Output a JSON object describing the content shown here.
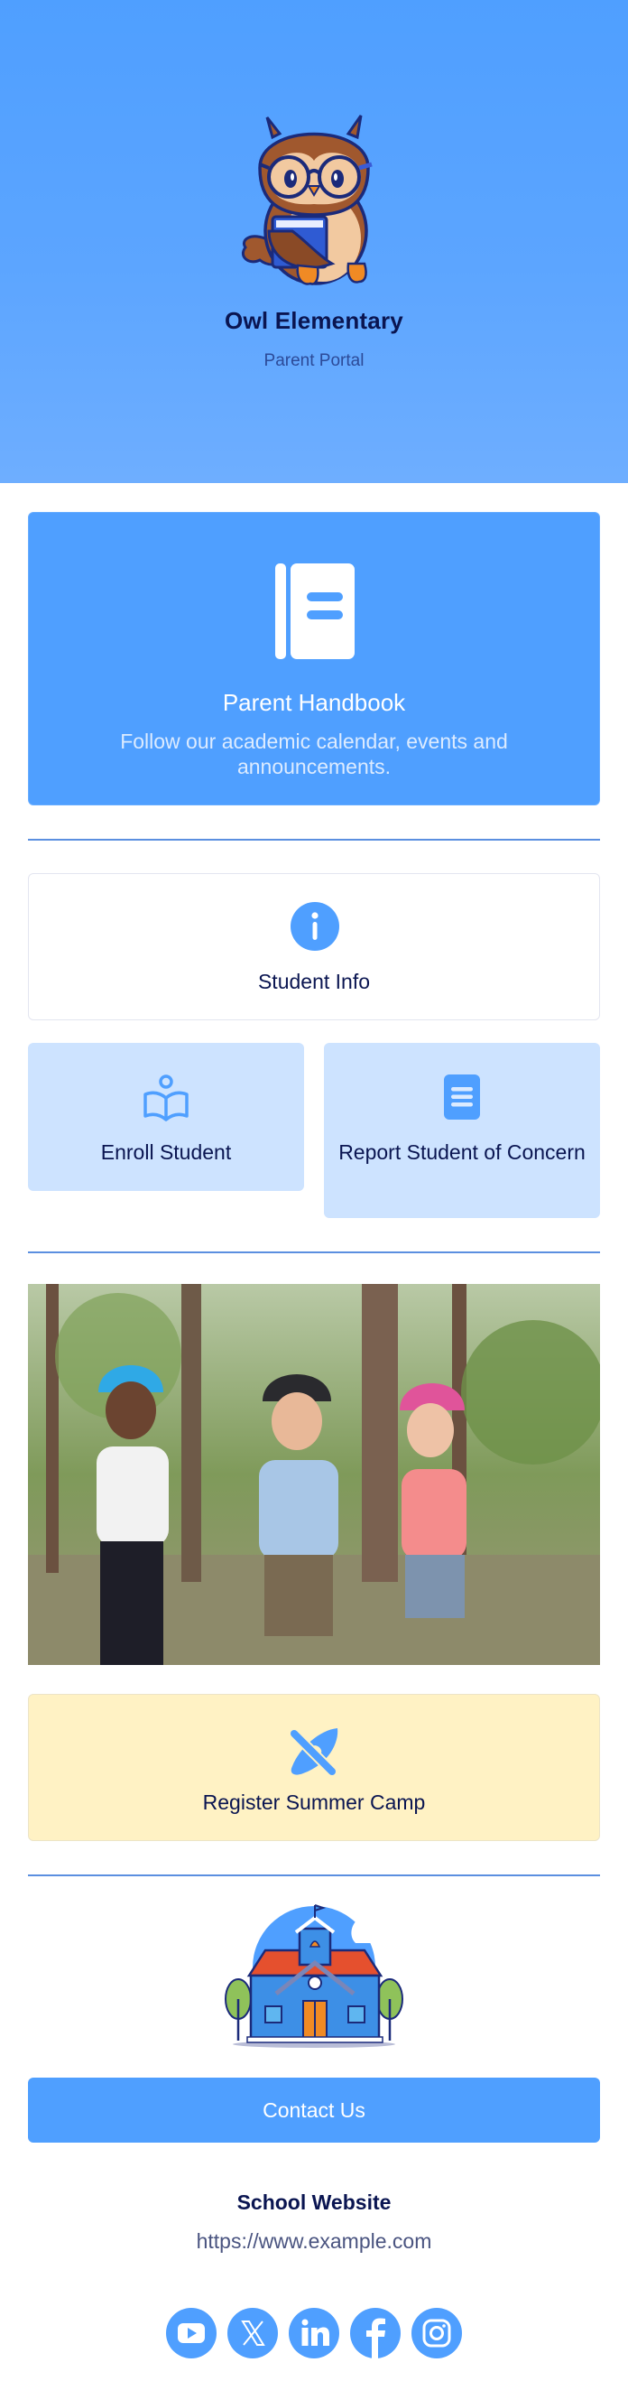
{
  "header": {
    "title": "Owl Elementary",
    "subtitle": "Parent Portal",
    "logo": "owl-reading-book-illustration",
    "gradient_top": "#4F9FFF",
    "gradient_bottom": "#6EAEFF"
  },
  "colors": {
    "primary": "#4F9FFF",
    "navy_text": "#0A1551",
    "tile_bg": "#CDE3FF",
    "camp_bg": "#FFF2C4",
    "divider": "#5B8FE0"
  },
  "handbook": {
    "icon": "notebook-icon",
    "title": "Parent Handbook",
    "description": "Follow our academic calendar, events and announcements."
  },
  "student_info": {
    "icon": "info-circle-icon",
    "label": "Student Info"
  },
  "tiles": [
    {
      "icon": "reading-person-icon",
      "label": "Enroll Student"
    },
    {
      "icon": "document-icon",
      "label": "Report Student of Concern"
    }
  ],
  "photo": {
    "description": "Three children wearing climbing helmets and harnesses holding ropes and carabiners in a forest"
  },
  "summer_camp": {
    "icon": "kayak-paddle-icon",
    "label": "Register Summer Camp"
  },
  "school_illustration": "school-building-illustration",
  "contact": {
    "label": "Contact Us"
  },
  "website": {
    "title": "School Website",
    "url": "https://www.example.com"
  },
  "socials": [
    {
      "name": "YouTube",
      "icon": "youtube-icon"
    },
    {
      "name": "X",
      "icon": "x-icon"
    },
    {
      "name": "LinkedIn",
      "icon": "linkedin-icon"
    },
    {
      "name": "Facebook",
      "icon": "facebook-icon"
    },
    {
      "name": "Instagram",
      "icon": "instagram-icon"
    }
  ]
}
